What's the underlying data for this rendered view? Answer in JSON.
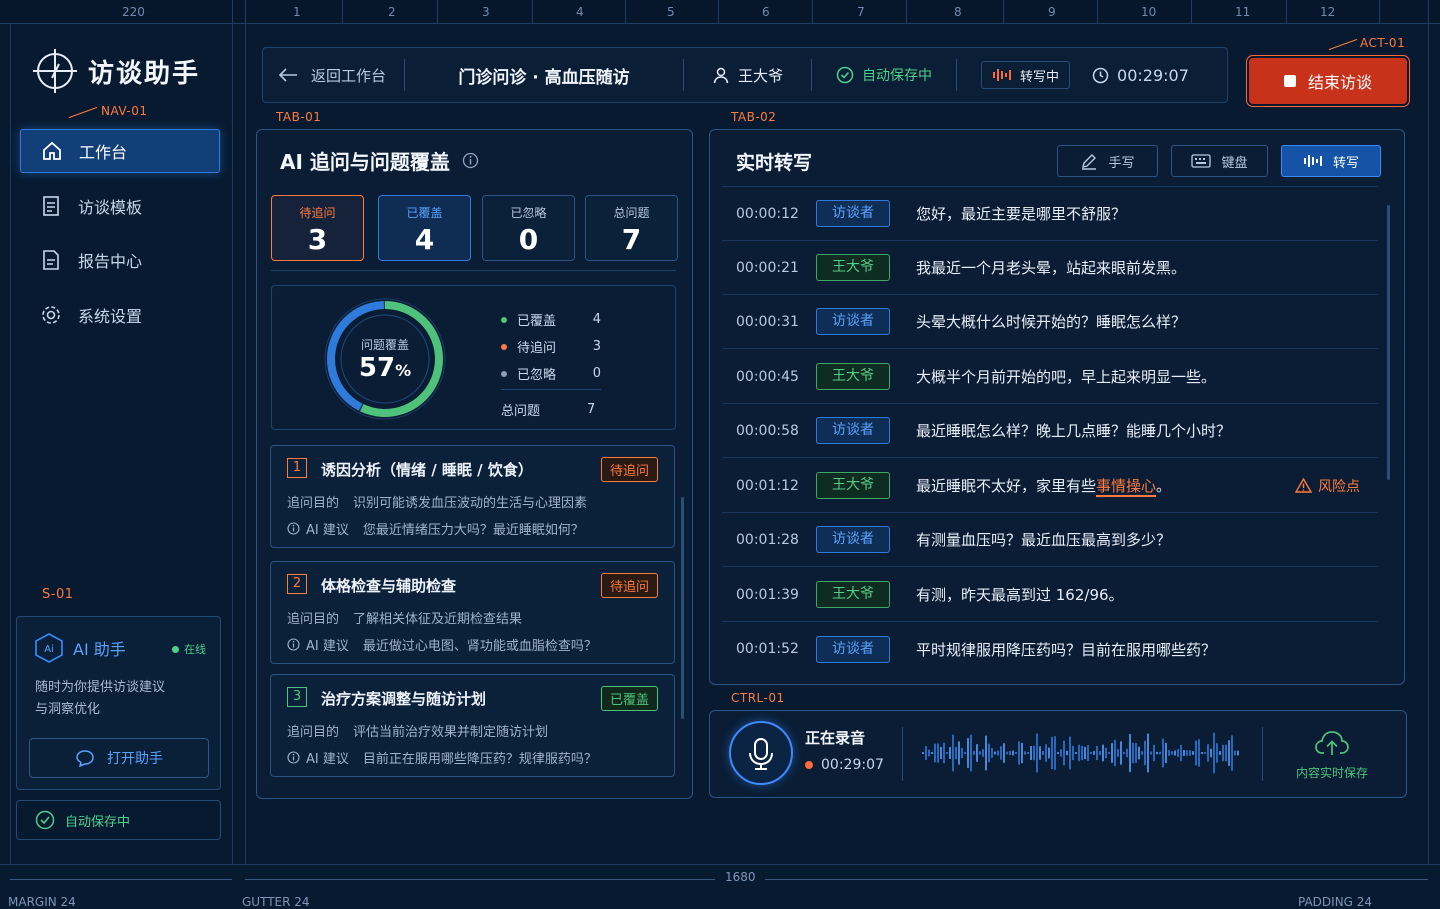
{
  "app": {
    "title": "访谈助手"
  },
  "ruler": {
    "labels": [
      "220",
      "1",
      "2",
      "3",
      "4",
      "5",
      "6",
      "7",
      "8",
      "9",
      "10",
      "11",
      "12"
    ],
    "width_label": "1680",
    "margin_label": "MARGIN 24",
    "gutter_label": "GUTTER 24",
    "padding_label": "PADDING 24"
  },
  "tags": {
    "nav": "NAV-01",
    "tab1": "TAB-01",
    "tab2": "TAB-02",
    "act": "ACT-01",
    "s": "S-01",
    "ctrl": "CTRL-01"
  },
  "sidebar": {
    "items": [
      {
        "label": "工作台",
        "icon": "home-icon",
        "active": true
      },
      {
        "label": "访谈模板",
        "icon": "document-icon"
      },
      {
        "label": "报告中心",
        "icon": "report-icon"
      },
      {
        "label": "系统设置",
        "icon": "gear-icon"
      }
    ]
  },
  "assistant": {
    "title": "AI 助手",
    "status": "在线",
    "desc_line1": "随时为你提供访谈建议",
    "desc_line2": "与洞察优化",
    "button": "打开助手"
  },
  "autosave_side": "自动保存中",
  "header": {
    "back": "返回工作台",
    "title": "门诊问诊 · 高血压随访",
    "patient": "王大爷",
    "autosave": "自动保存中",
    "transcribing": "转写中",
    "timer": "00:29:07"
  },
  "end_button": "结束访谈",
  "coverage": {
    "title": "AI 追问与问题覆盖",
    "stats": [
      {
        "label": "待追问",
        "value": "3"
      },
      {
        "label": "已覆盖",
        "value": "4"
      },
      {
        "label": "已忽略",
        "value": "0"
      },
      {
        "label": "总问题",
        "value": "7"
      }
    ],
    "donut_label": "问题覆盖",
    "percent": "57",
    "percent_unit": "%",
    "percent_value": 57,
    "legend": [
      {
        "label": "已覆盖",
        "value": "4",
        "color": "#4ec27a"
      },
      {
        "label": "待追问",
        "value": "3",
        "color": "#ff7b3d"
      },
      {
        "label": "已忽略",
        "value": "0",
        "color": "#8d9db3"
      }
    ],
    "total_label": "总问题",
    "total_value": "7"
  },
  "cards": [
    {
      "num": "1",
      "title": "诱因分析（情绪 / 睡眠 / 饮食）",
      "badge": "待追问",
      "purpose_label": "追问目的",
      "purpose": "识别可能诱发血压波动的生活与心理因素",
      "ai_label": "AI 建议",
      "ai": "您最近情绪压力大吗？最近睡眠如何？"
    },
    {
      "num": "2",
      "title": "体格检查与辅助检查",
      "badge": "待追问",
      "purpose_label": "追问目的",
      "purpose": "了解相关体征及近期检查结果",
      "ai_label": "AI 建议",
      "ai": "最近做过心电图、肾功能或血脂检查吗？"
    },
    {
      "num": "3",
      "title": "治疗方案调整与随访计划",
      "badge": "已覆盖",
      "purpose_label": "追问目的",
      "purpose": "评估当前治疗效果并制定随访计划",
      "ai_label": "AI 建议",
      "ai": "目前正在服用哪些降压药？规律服药吗？"
    }
  ],
  "transcript": {
    "title": "实时转写",
    "modes": [
      "手写",
      "键盘",
      "转写"
    ],
    "rows": [
      {
        "time": "00:00:12",
        "speaker": "访谈者",
        "text": "您好，最近主要是哪里不舒服？"
      },
      {
        "time": "00:00:21",
        "speaker": "王大爷",
        "text": "我最近一个月老头晕，站起来眼前发黑。"
      },
      {
        "time": "00:00:31",
        "speaker": "访谈者",
        "text": "头晕大概什么时候开始的？睡眠怎么样？"
      },
      {
        "time": "00:00:45",
        "speaker": "王大爷",
        "text": "大概半个月前开始的吧，早上起来明显一些。"
      },
      {
        "time": "00:00:58",
        "speaker": "访谈者",
        "text": "最近睡眠怎么样？晚上几点睡？能睡几个小时？"
      },
      {
        "time": "00:01:12",
        "speaker": "王大爷",
        "text_pre": "最近睡眠不太好，家里有些",
        "text_hl": "事情操心",
        "text_post": "。",
        "risk": "风险点"
      },
      {
        "time": "00:01:28",
        "speaker": "访谈者",
        "text": "有测量血压吗？最近血压最高到多少？"
      },
      {
        "time": "00:01:39",
        "speaker": "王大爷",
        "text": "有测，昨天最高到过 162/96。"
      },
      {
        "time": "00:01:52",
        "speaker": "访谈者",
        "text": "平时规律服用降压药吗？目前在服用哪些药？"
      }
    ]
  },
  "recorder": {
    "status": "正在录音",
    "time": "00:29:07",
    "save": "内容实时保存"
  }
}
